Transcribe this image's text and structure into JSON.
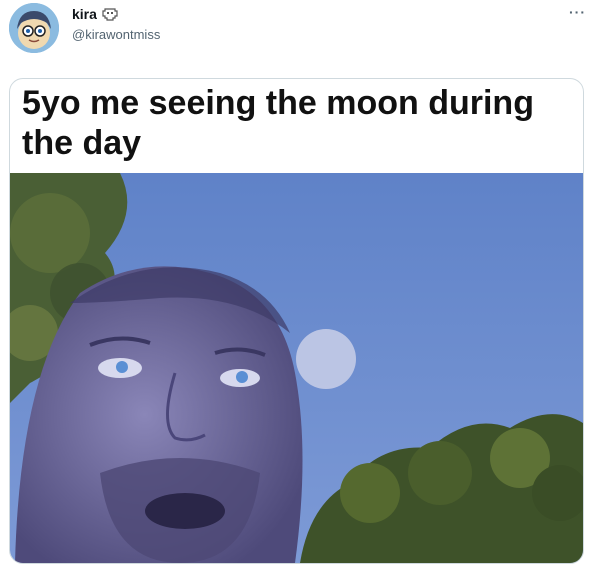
{
  "tweet": {
    "display_name": "kira",
    "name_emoji_icon": "alien-monster-icon",
    "handle": "@kirawontmiss",
    "more_label": "···",
    "caption": "5yo me seeing the moon during the day"
  },
  "colors": {
    "sky": "#6f8fd0",
    "moon": "#c9cfe8",
    "foliage": "#3f5a2b",
    "text_secondary": "#536471"
  }
}
